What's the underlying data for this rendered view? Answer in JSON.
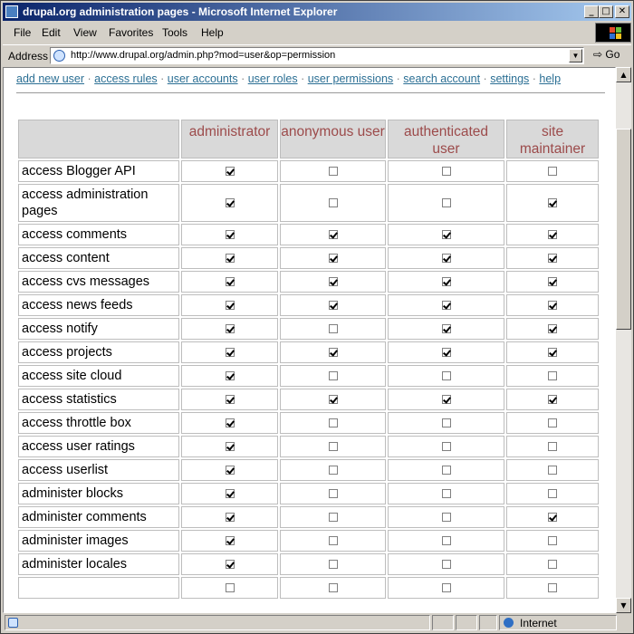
{
  "window": {
    "title": "drupal.org administration pages - Microsoft Internet Explorer"
  },
  "menu": [
    "File",
    "Edit",
    "View",
    "Favorites",
    "Tools",
    "Help"
  ],
  "address": {
    "label": "Address",
    "url": "http://www.drupal.org/admin.php?mod=user&op=permission",
    "go_label": "Go"
  },
  "admin_nav": [
    "add new user",
    "access rules",
    "user accounts",
    "user roles",
    "user permissions",
    "search account",
    "settings",
    "help"
  ],
  "table": {
    "roles": [
      "administrator",
      "anonymous user",
      "authenticated user",
      "site maintainer"
    ],
    "rows": [
      {
        "name": "access Blogger API",
        "perms": [
          true,
          false,
          false,
          false
        ]
      },
      {
        "name": "access administration pages",
        "perms": [
          true,
          false,
          false,
          true
        ]
      },
      {
        "name": "access comments",
        "perms": [
          true,
          true,
          true,
          true
        ]
      },
      {
        "name": "access content",
        "perms": [
          true,
          true,
          true,
          true
        ]
      },
      {
        "name": "access cvs messages",
        "perms": [
          true,
          true,
          true,
          true
        ]
      },
      {
        "name": "access news feeds",
        "perms": [
          true,
          true,
          true,
          true
        ]
      },
      {
        "name": "access notify",
        "perms": [
          true,
          false,
          true,
          true
        ]
      },
      {
        "name": "access projects",
        "perms": [
          true,
          true,
          true,
          true
        ]
      },
      {
        "name": "access site cloud",
        "perms": [
          true,
          false,
          false,
          false
        ]
      },
      {
        "name": "access statistics",
        "perms": [
          true,
          true,
          true,
          true
        ]
      },
      {
        "name": "access throttle box",
        "perms": [
          true,
          false,
          false,
          false
        ]
      },
      {
        "name": "access user ratings",
        "perms": [
          true,
          false,
          false,
          false
        ]
      },
      {
        "name": "access userlist",
        "perms": [
          true,
          false,
          false,
          false
        ]
      },
      {
        "name": "administer blocks",
        "perms": [
          true,
          false,
          false,
          false
        ]
      },
      {
        "name": "administer comments",
        "perms": [
          true,
          false,
          false,
          true
        ]
      },
      {
        "name": "administer images",
        "perms": [
          true,
          false,
          false,
          false
        ]
      },
      {
        "name": "administer locales",
        "perms": [
          true,
          false,
          false,
          false
        ]
      },
      {
        "name": "",
        "perms": [
          false,
          false,
          false,
          false
        ]
      }
    ]
  },
  "status": {
    "zone": "Internet"
  }
}
